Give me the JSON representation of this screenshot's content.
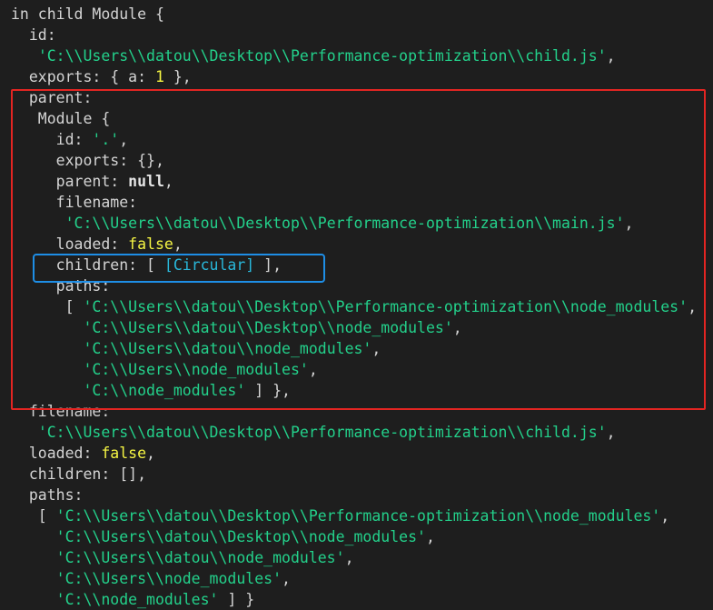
{
  "terminal": {
    "lines": [
      [
        {
          "t": "plain",
          "v": "in child Module {"
        }
      ],
      [
        {
          "t": "plain",
          "v": "  id:"
        }
      ],
      [
        {
          "t": "plain",
          "v": "   "
        },
        {
          "t": "str",
          "v": "'C:\\\\Users\\\\datou\\\\Desktop\\\\Performance-optimization\\\\child.js'"
        },
        {
          "t": "punc",
          "v": ","
        }
      ],
      [
        {
          "t": "plain",
          "v": "  exports: { a: "
        },
        {
          "t": "num",
          "v": "1"
        },
        {
          "t": "punc",
          "v": " },"
        }
      ],
      [
        {
          "t": "plain",
          "v": "  parent:"
        }
      ],
      [
        {
          "t": "plain",
          "v": "   Module {"
        }
      ],
      [
        {
          "t": "plain",
          "v": "     id: "
        },
        {
          "t": "str",
          "v": "'.'"
        },
        {
          "t": "punc",
          "v": ","
        }
      ],
      [
        {
          "t": "plain",
          "v": "     exports: {},"
        }
      ],
      [
        {
          "t": "plain",
          "v": "     parent: "
        },
        {
          "t": "null",
          "v": "null"
        },
        {
          "t": "punc",
          "v": ","
        }
      ],
      [
        {
          "t": "plain",
          "v": "     filename:"
        }
      ],
      [
        {
          "t": "plain",
          "v": "      "
        },
        {
          "t": "str",
          "v": "'C:\\\\Users\\\\datou\\\\Desktop\\\\Performance-optimization\\\\main.js'"
        },
        {
          "t": "punc",
          "v": ","
        }
      ],
      [
        {
          "t": "plain",
          "v": "     loaded: "
        },
        {
          "t": "bool",
          "v": "false"
        },
        {
          "t": "punc",
          "v": ","
        }
      ],
      [
        {
          "t": "plain",
          "v": "     children: [ "
        },
        {
          "t": "special",
          "v": "[Circular]"
        },
        {
          "t": "punc",
          "v": " ],"
        }
      ],
      [
        {
          "t": "plain",
          "v": "     paths:"
        }
      ],
      [
        {
          "t": "plain",
          "v": "      [ "
        },
        {
          "t": "str",
          "v": "'C:\\\\Users\\\\datou\\\\Desktop\\\\Performance-optimization\\\\node_modules'"
        },
        {
          "t": "punc",
          "v": ","
        }
      ],
      [
        {
          "t": "plain",
          "v": "        "
        },
        {
          "t": "str",
          "v": "'C:\\\\Users\\\\datou\\\\Desktop\\\\node_modules'"
        },
        {
          "t": "punc",
          "v": ","
        }
      ],
      [
        {
          "t": "plain",
          "v": "        "
        },
        {
          "t": "str",
          "v": "'C:\\\\Users\\\\datou\\\\node_modules'"
        },
        {
          "t": "punc",
          "v": ","
        }
      ],
      [
        {
          "t": "plain",
          "v": "        "
        },
        {
          "t": "str",
          "v": "'C:\\\\Users\\\\node_modules'"
        },
        {
          "t": "punc",
          "v": ","
        }
      ],
      [
        {
          "t": "plain",
          "v": "        "
        },
        {
          "t": "str",
          "v": "'C:\\\\node_modules'"
        },
        {
          "t": "punc",
          "v": " ] },"
        }
      ],
      [
        {
          "t": "plain",
          "v": "  filename:"
        }
      ],
      [
        {
          "t": "plain",
          "v": "   "
        },
        {
          "t": "str",
          "v": "'C:\\\\Users\\\\datou\\\\Desktop\\\\Performance-optimization\\\\child.js'"
        },
        {
          "t": "punc",
          "v": ","
        }
      ],
      [
        {
          "t": "plain",
          "v": "  loaded: "
        },
        {
          "t": "bool",
          "v": "false"
        },
        {
          "t": "punc",
          "v": ","
        }
      ],
      [
        {
          "t": "plain",
          "v": "  children: [],"
        }
      ],
      [
        {
          "t": "plain",
          "v": "  paths:"
        }
      ],
      [
        {
          "t": "plain",
          "v": "   [ "
        },
        {
          "t": "str",
          "v": "'C:\\\\Users\\\\datou\\\\Desktop\\\\Performance-optimization\\\\node_modules'"
        },
        {
          "t": "punc",
          "v": ","
        }
      ],
      [
        {
          "t": "plain",
          "v": "     "
        },
        {
          "t": "str",
          "v": "'C:\\\\Users\\\\datou\\\\Desktop\\\\node_modules'"
        },
        {
          "t": "punc",
          "v": ","
        }
      ],
      [
        {
          "t": "plain",
          "v": "     "
        },
        {
          "t": "str",
          "v": "'C:\\\\Users\\\\datou\\\\node_modules'"
        },
        {
          "t": "punc",
          "v": ","
        }
      ],
      [
        {
          "t": "plain",
          "v": "     "
        },
        {
          "t": "str",
          "v": "'C:\\\\Users\\\\node_modules'"
        },
        {
          "t": "punc",
          "v": ","
        }
      ],
      [
        {
          "t": "plain",
          "v": "     "
        },
        {
          "t": "str",
          "v": "'C:\\\\node_modules'"
        },
        {
          "t": "punc",
          "v": " ] }"
        }
      ]
    ]
  },
  "colors": {
    "background": "#1e1e1e",
    "text": "#d4d4d4",
    "string": "#23d18b",
    "number_boolean": "#f5f543",
    "circular": "#29b8db",
    "parent_box": "#e32522",
    "children_box": "#1e8ee6"
  }
}
